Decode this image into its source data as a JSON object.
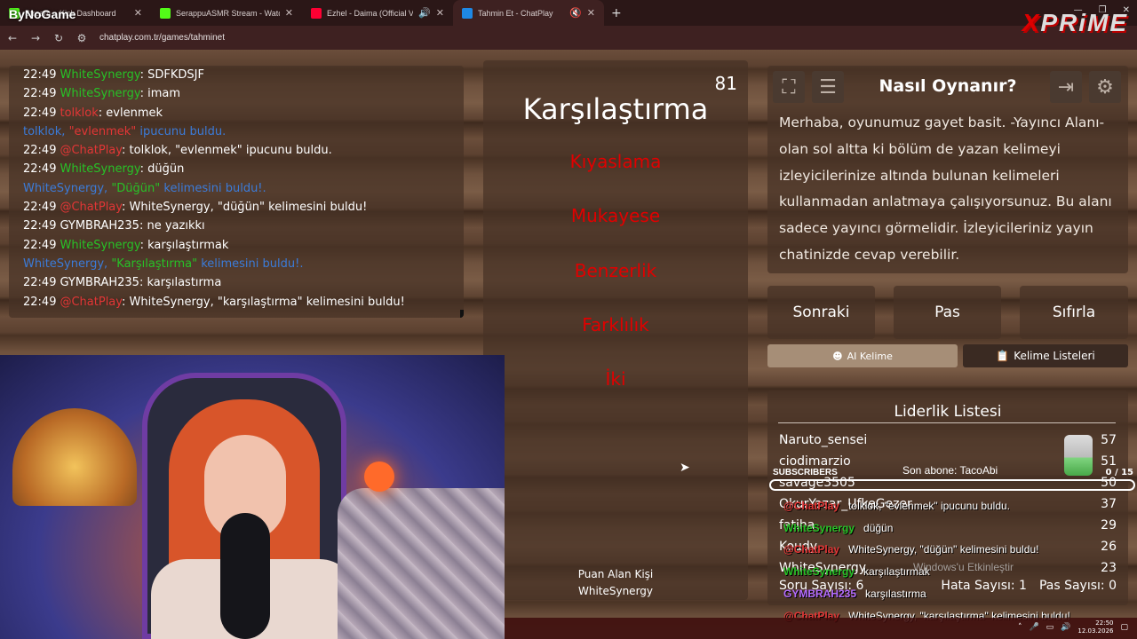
{
  "browser": {
    "tabs": [
      {
        "label": "Stream – Kick Dashboard",
        "color": "#53fc18"
      },
      {
        "label": "SerappuASMR Stream - Watch",
        "color": "#53fc18"
      },
      {
        "label": "Ezhel - Daima (Official Video)",
        "color": "#ff0033"
      },
      {
        "label": "Tahmin Et - ChatPlay",
        "color": "#1e88e5"
      }
    ],
    "url": "chatplay.com.tr/games/tahminet",
    "overlay_logo": "ByNoGame",
    "brand": "PRiME"
  },
  "chat": {
    "lines": [
      {
        "time": "22:49",
        "user": "WhiteSynergy",
        "sep": ": ",
        "msg": "SDFKDSJF",
        "uclass": "c-green"
      },
      {
        "time": "22:49",
        "user": "WhiteSynergy",
        "sep": ": ",
        "msg": "imam",
        "uclass": "c-green"
      },
      {
        "time": "22:49",
        "user": "tolklok",
        "sep": ": ",
        "msg": "evlenmek",
        "uclass": "c-red"
      },
      {
        "time": "",
        "user": "tolklok, ",
        "sep": "\"evlenmek\"",
        "msg": " ipucunu buldu.",
        "uclass": "c-blue",
        "sclass": "c-red",
        "mclass": "c-blue"
      },
      {
        "time": "22:49",
        "user": "@ChatPlay",
        "sep": ": ",
        "msg": "tolklok, \"evlenmek\" ipucunu buldu.",
        "uclass": "c-red"
      },
      {
        "time": "22:49",
        "user": "WhiteSynergy",
        "sep": ": ",
        "msg": "düğün",
        "uclass": "c-green"
      },
      {
        "time": "",
        "user": "WhiteSynergy, ",
        "sep": "\"Düğün\"",
        "msg": " kelimesini buldu!.",
        "uclass": "c-blue",
        "sclass": "c-green",
        "mclass": "c-blue"
      },
      {
        "time": "22:49",
        "user": "@ChatPlay",
        "sep": ": ",
        "msg": "WhiteSynergy, \"düğün\" kelimesini buldu!",
        "uclass": "c-red"
      },
      {
        "time": "22:49",
        "user": "GYMBRAH235",
        "sep": ": ",
        "msg": "ne yazıkkı",
        "uclass": ""
      },
      {
        "time": "22:49",
        "user": "WhiteSynergy",
        "sep": ": ",
        "msg": "karşılaştırmak",
        "uclass": "c-green"
      },
      {
        "time": "",
        "user": "WhiteSynergy, ",
        "sep": "\"Karşılaştırma\"",
        "msg": " kelimesini buldu!.",
        "uclass": "c-blue",
        "sclass": "c-green",
        "mclass": "c-blue"
      },
      {
        "time": "22:49",
        "user": "GYMBRAH235",
        "sep": ": ",
        "msg": "karşılastırma",
        "uclass": ""
      },
      {
        "time": "22:49",
        "user": "@ChatPlay",
        "sep": ": ",
        "msg": "WhiteSynergy, \"karşılaştırma\" kelimesini buldu!",
        "uclass": "c-red"
      }
    ]
  },
  "word_card": {
    "time_left": "81",
    "title": "Karşılaştırma",
    "taboo_words": [
      "Kıyaslama",
      "Mukayese",
      "Benzerlik",
      "Farklılık",
      "İki"
    ],
    "point_label": "Puan Alan Kişi",
    "point_user": "WhiteSynergy"
  },
  "howto": {
    "title": "Nasıl Oynanır?",
    "text": "Merhaba, oyunumuz gayet basit. -Yayıncı Alanı- olan sol altta ki bölüm de yazan kelimeyi izleyicilerinize altında bulunan kelimeleri kullanmadan anlatmaya çalışıyorsunuz. Bu alanı sadece yayıncı görmelidir. İzleyicileriniz yayın chatinizde cevap verebilir."
  },
  "controls": {
    "next": "Sonraki",
    "pass": "Pas",
    "reset": "Sıfırla",
    "ai_word": "AI Kelime",
    "word_lists": "Kelime Listeleri"
  },
  "leaderboard": {
    "title": "Liderlik Listesi",
    "rows": [
      {
        "name": "Naruto_sensei",
        "score": "57"
      },
      {
        "name": "ciodimarzio",
        "score": "51"
      },
      {
        "name": "savage3505",
        "score": "50"
      },
      {
        "name": "OkurYazar_UfkeGezer",
        "score": "37"
      },
      {
        "name": "fatiha",
        "score": "29"
      },
      {
        "name": "Koudy",
        "score": "26"
      },
      {
        "name": "WhiteSynergy",
        "score": "23"
      }
    ],
    "question_count": "Soru Sayısı: 6",
    "error_count": "Hata Sayısı: 1",
    "pass_count": "Pas Sayısı: 0"
  },
  "stream_overlay": {
    "subscribers_label": "SUBSCRIBERS",
    "last_sub": "Son abone: TacoAbi",
    "sub_count": "0 / 15",
    "chat": [
      {
        "user": "@ChatPlay",
        "msg": "tolklok, \"evlenmek\" ipucunu buldu.",
        "color": "#e23636"
      },
      {
        "user": "WhiteSynergy",
        "msg": "düğün",
        "color": "#27c227"
      },
      {
        "user": "@ChatPlay",
        "msg": "WhiteSynergy, \"düğün\" kelimesini buldu!",
        "color": "#e23636"
      },
      {
        "user": "WhiteSynergy",
        "msg": "karşılaştırmak",
        "color": "#27c227"
      },
      {
        "user": "GYMBRAH235",
        "msg": "karşılastırma",
        "color": "#b36bff"
      },
      {
        "user": "@ChatPlay",
        "msg": "WhiteSynergy, \"karşılaştırma\" kelimesini buldu!",
        "color": "#e23636"
      }
    ]
  },
  "windows": {
    "watermark": "Windows'u Etkinleştir",
    "clock_time": "22:50",
    "clock_date": "12.03.2026"
  }
}
